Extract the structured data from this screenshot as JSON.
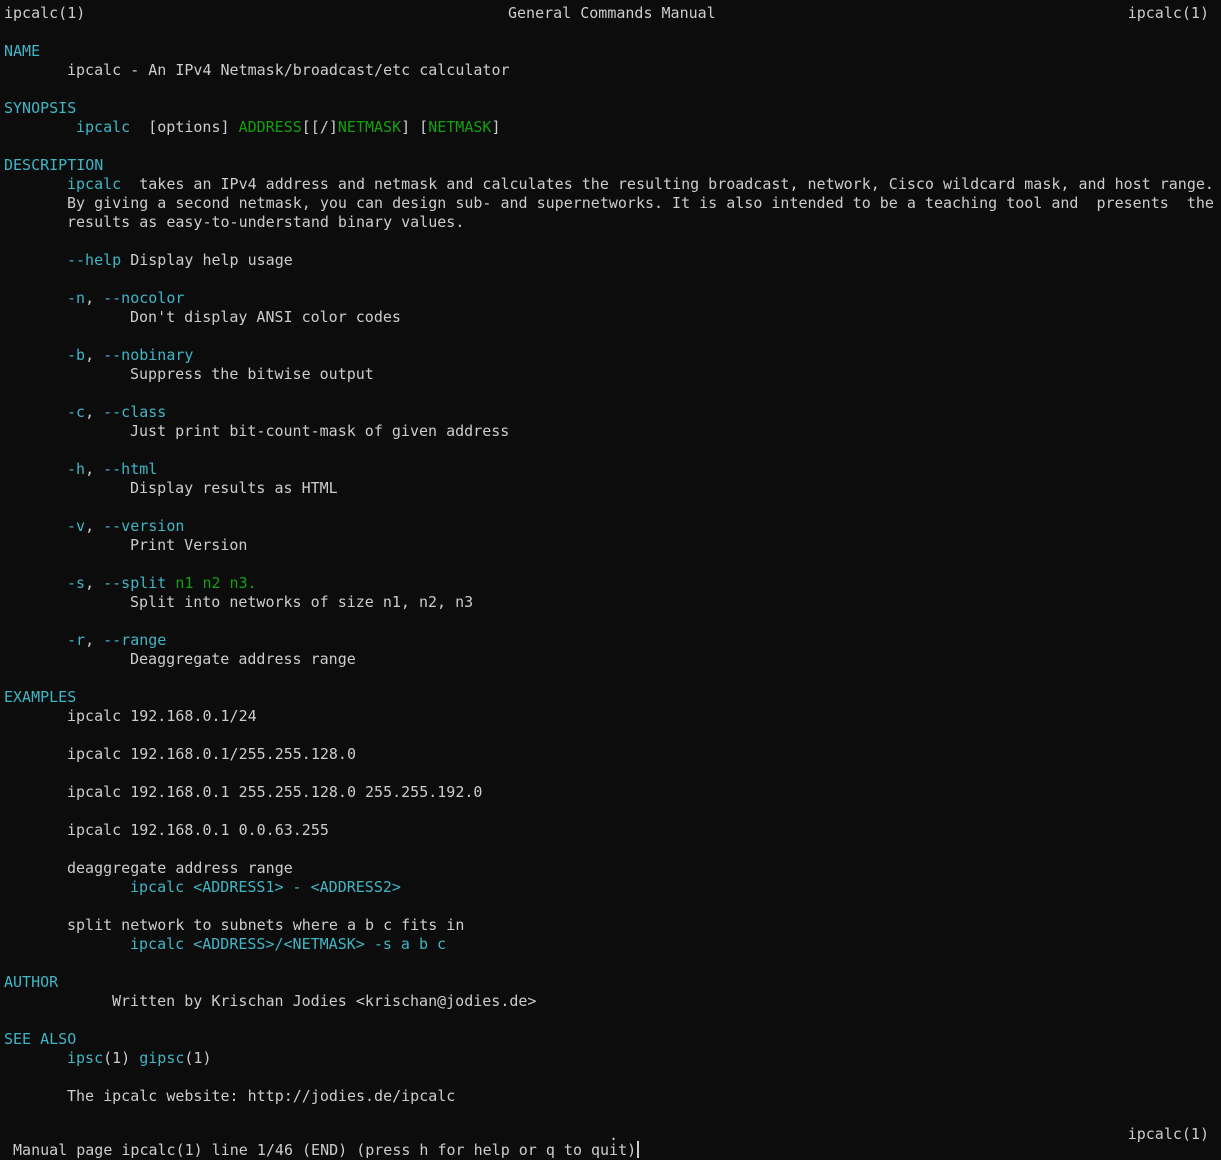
{
  "header": {
    "left": "ipcalc(1)",
    "center": "General Commands Manual",
    "right": "ipcalc(1)"
  },
  "name": {
    "heading": "NAME",
    "text": "ipcalc - An IPv4 Netmask/broadcast/etc calculator"
  },
  "synopsis": {
    "heading": "SYNOPSIS",
    "cmd": "ipcalc",
    "options": "  [options] ",
    "address": "ADDRESS",
    "bracket1": "[[/]",
    "netmask1": "NETMASK",
    "bracket2": "] [",
    "netmask2": "NETMASK",
    "bracket3": "]"
  },
  "description": {
    "heading": "DESCRIPTION",
    "cmd": "ipcalc",
    "line1": "  takes an IPv4 address and netmask and calculates the resulting broadcast, network, Cisco wildcard mask, and host range.",
    "line2": "By giving a second netmask, you can design sub- and supernetworks. It is also intended to be a teaching tool and  presents  the",
    "line3": "results as easy-to-understand binary values."
  },
  "options": {
    "help_flag": "--help",
    "help_text": " Display help usage",
    "nocolor_short": "-n",
    "nocolor_long": "--nocolor",
    "nocolor_text": "Don't display ANSI color codes",
    "nobinary_short": "-b",
    "nobinary_long": "--nobinary",
    "nobinary_text": "Suppress the bitwise output",
    "class_short": "-c",
    "class_long": "--class",
    "class_text": "Just print bit-count-mask of given address",
    "html_short": "-h",
    "html_long": "--html",
    "html_text": "Display results as HTML",
    "version_short": "-v",
    "version_long": "--version",
    "version_text": "Print Version",
    "split_short": "-s",
    "split_long": "--split",
    "split_args": " n1 n2 n3.",
    "split_text": "Split into networks of size n1, n2, n3",
    "range_short": "-r",
    "range_long": "--range",
    "range_text": "Deaggregate address range",
    "sep": ", "
  },
  "examples": {
    "heading": "EXAMPLES",
    "ex1": "ipcalc 192.168.0.1/24",
    "ex2": "ipcalc 192.168.0.1/255.255.128.0",
    "ex3": "ipcalc 192.168.0.1 255.255.128.0 255.255.192.0",
    "ex4": "ipcalc 192.168.0.1 0.0.63.255",
    "deagg_label": "deaggregate address range",
    "deagg_cmd": "ipcalc <ADDRESS1> - <ADDRESS2>",
    "split_label": "split network to subnets where a b c fits in",
    "split_cmd": "ipcalc <ADDRESS>/<NETMASK> -s a b c"
  },
  "author": {
    "heading": "AUTHOR",
    "text": "Written by Krischan Jodies <krischan@jodies.de>"
  },
  "see_also": {
    "heading": "SEE ALSO",
    "ref1": "ipsc",
    "ref1_sec": "(1) ",
    "ref2": "gipsc",
    "ref2_sec": "(1)",
    "website": "The ipcalc website: http://jodies.de/ipcalc"
  },
  "footer": {
    "right": "ipcalc(1)",
    "dot": ".",
    "status": " Manual page ipcalc(1) line 1/46 (END) (press h for help or q to quit)"
  },
  "colors": {
    "background": "#0c0c0c",
    "foreground": "#cccccc",
    "heading_cyan": "#3fb6c6",
    "argument_green": "#13a10e"
  }
}
